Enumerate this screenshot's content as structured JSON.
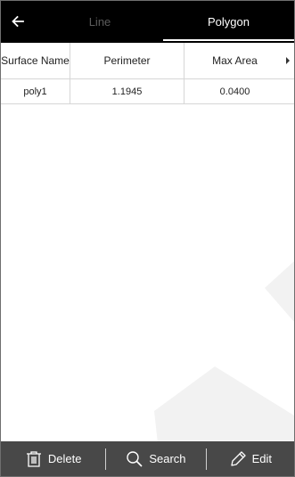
{
  "header": {
    "back_icon": "arrow-left-icon",
    "tabs": [
      {
        "label": "Line",
        "active": false
      },
      {
        "label": "Polygon",
        "active": true
      }
    ]
  },
  "table": {
    "columns": [
      "Surface Name",
      "Perimeter",
      "Max Area"
    ],
    "rows": [
      {
        "surface_name": "poly1",
        "perimeter": "1.1945",
        "max_area": "0.0400"
      }
    ]
  },
  "toolbar": {
    "delete_label": "Delete",
    "search_label": "Search",
    "edit_label": "Edit",
    "delete_icon": "trash-icon",
    "search_icon": "magnifier-icon",
    "edit_icon": "pencil-icon"
  },
  "colors": {
    "header_bg": "#000000",
    "active_tab": "#ffffff",
    "inactive_tab": "#5c5c5c",
    "toolbar_bg": "#484848"
  }
}
